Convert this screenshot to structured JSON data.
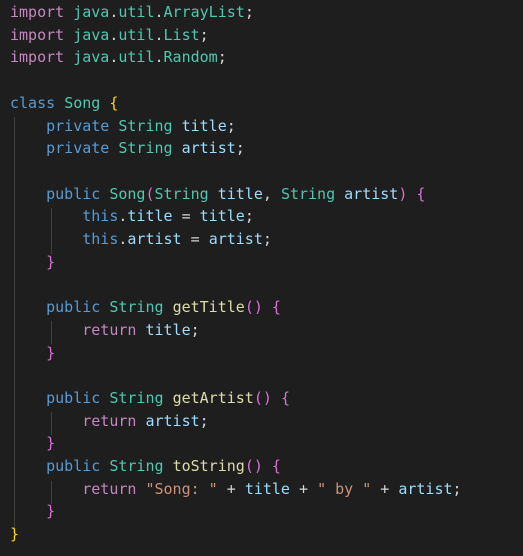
{
  "editor": {
    "language": "java",
    "theme": "dark",
    "colors": {
      "background": "#1e1e1e",
      "keyword": "#569cd6",
      "control_keyword": "#c586c0",
      "type": "#4ec9b0",
      "variable": "#9cdcfe",
      "function": "#dcdcaa",
      "string": "#ce9178",
      "bracket_level1": "#ffd700",
      "bracket_level2": "#da70d6",
      "bracket_level3": "#179fff"
    },
    "lines": [
      [
        {
          "t": "import",
          "c": "ctrl"
        },
        {
          "t": " ",
          "c": "plain"
        },
        {
          "t": "java",
          "c": "type"
        },
        {
          "t": ".",
          "c": "plain"
        },
        {
          "t": "util",
          "c": "type"
        },
        {
          "t": ".",
          "c": "plain"
        },
        {
          "t": "ArrayList",
          "c": "type"
        },
        {
          "t": ";",
          "c": "plain"
        }
      ],
      [
        {
          "t": "import",
          "c": "ctrl"
        },
        {
          "t": " ",
          "c": "plain"
        },
        {
          "t": "java",
          "c": "type"
        },
        {
          "t": ".",
          "c": "plain"
        },
        {
          "t": "util",
          "c": "type"
        },
        {
          "t": ".",
          "c": "plain"
        },
        {
          "t": "List",
          "c": "type"
        },
        {
          "t": ";",
          "c": "plain"
        }
      ],
      [
        {
          "t": "import",
          "c": "ctrl"
        },
        {
          "t": " ",
          "c": "plain"
        },
        {
          "t": "java",
          "c": "type"
        },
        {
          "t": ".",
          "c": "plain"
        },
        {
          "t": "util",
          "c": "type"
        },
        {
          "t": ".",
          "c": "plain"
        },
        {
          "t": "Random",
          "c": "type"
        },
        {
          "t": ";",
          "c": "plain"
        }
      ],
      [],
      [
        {
          "t": "class",
          "c": "kw"
        },
        {
          "t": " ",
          "c": "plain"
        },
        {
          "t": "Song",
          "c": "type"
        },
        {
          "t": " ",
          "c": "plain"
        },
        {
          "t": "{",
          "c": "b1"
        }
      ],
      [
        {
          "t": "    ",
          "c": "plain"
        },
        {
          "t": "private",
          "c": "kw"
        },
        {
          "t": " ",
          "c": "plain"
        },
        {
          "t": "String",
          "c": "type"
        },
        {
          "t": " ",
          "c": "plain"
        },
        {
          "t": "title",
          "c": "var"
        },
        {
          "t": ";",
          "c": "plain"
        }
      ],
      [
        {
          "t": "    ",
          "c": "plain"
        },
        {
          "t": "private",
          "c": "kw"
        },
        {
          "t": " ",
          "c": "plain"
        },
        {
          "t": "String",
          "c": "type"
        },
        {
          "t": " ",
          "c": "plain"
        },
        {
          "t": "artist",
          "c": "var"
        },
        {
          "t": ";",
          "c": "plain"
        }
      ],
      [],
      [
        {
          "t": "    ",
          "c": "plain"
        },
        {
          "t": "public",
          "c": "kw"
        },
        {
          "t": " ",
          "c": "plain"
        },
        {
          "t": "Song",
          "c": "type"
        },
        {
          "t": "(",
          "c": "b2"
        },
        {
          "t": "String",
          "c": "type"
        },
        {
          "t": " ",
          "c": "plain"
        },
        {
          "t": "title",
          "c": "var"
        },
        {
          "t": ", ",
          "c": "plain"
        },
        {
          "t": "String",
          "c": "type"
        },
        {
          "t": " ",
          "c": "plain"
        },
        {
          "t": "artist",
          "c": "var"
        },
        {
          "t": ")",
          "c": "b2"
        },
        {
          "t": " ",
          "c": "plain"
        },
        {
          "t": "{",
          "c": "b2"
        }
      ],
      [
        {
          "t": "        ",
          "c": "plain"
        },
        {
          "t": "this",
          "c": "kw"
        },
        {
          "t": ".",
          "c": "plain"
        },
        {
          "t": "title",
          "c": "var"
        },
        {
          "t": " = ",
          "c": "plain"
        },
        {
          "t": "title",
          "c": "var"
        },
        {
          "t": ";",
          "c": "plain"
        }
      ],
      [
        {
          "t": "        ",
          "c": "plain"
        },
        {
          "t": "this",
          "c": "kw"
        },
        {
          "t": ".",
          "c": "plain"
        },
        {
          "t": "artist",
          "c": "var"
        },
        {
          "t": " = ",
          "c": "plain"
        },
        {
          "t": "artist",
          "c": "var"
        },
        {
          "t": ";",
          "c": "plain"
        }
      ],
      [
        {
          "t": "    ",
          "c": "plain"
        },
        {
          "t": "}",
          "c": "b2"
        }
      ],
      [],
      [
        {
          "t": "    ",
          "c": "plain"
        },
        {
          "t": "public",
          "c": "kw"
        },
        {
          "t": " ",
          "c": "plain"
        },
        {
          "t": "String",
          "c": "type"
        },
        {
          "t": " ",
          "c": "plain"
        },
        {
          "t": "getTitle",
          "c": "fn"
        },
        {
          "t": "()",
          "c": "b2"
        },
        {
          "t": " ",
          "c": "plain"
        },
        {
          "t": "{",
          "c": "b2"
        }
      ],
      [
        {
          "t": "        ",
          "c": "plain"
        },
        {
          "t": "return",
          "c": "ctrl"
        },
        {
          "t": " ",
          "c": "plain"
        },
        {
          "t": "title",
          "c": "var"
        },
        {
          "t": ";",
          "c": "plain"
        }
      ],
      [
        {
          "t": "    ",
          "c": "plain"
        },
        {
          "t": "}",
          "c": "b2"
        }
      ],
      [],
      [
        {
          "t": "    ",
          "c": "plain"
        },
        {
          "t": "public",
          "c": "kw"
        },
        {
          "t": " ",
          "c": "plain"
        },
        {
          "t": "String",
          "c": "type"
        },
        {
          "t": " ",
          "c": "plain"
        },
        {
          "t": "getArtist",
          "c": "fn"
        },
        {
          "t": "()",
          "c": "b2"
        },
        {
          "t": " ",
          "c": "plain"
        },
        {
          "t": "{",
          "c": "b2"
        }
      ],
      [
        {
          "t": "        ",
          "c": "plain"
        },
        {
          "t": "return",
          "c": "ctrl"
        },
        {
          "t": " ",
          "c": "plain"
        },
        {
          "t": "artist",
          "c": "var"
        },
        {
          "t": ";",
          "c": "plain"
        }
      ],
      [
        {
          "t": "    ",
          "c": "plain"
        },
        {
          "t": "}",
          "c": "b2"
        }
      ],
      [
        {
          "t": "    ",
          "c": "plain"
        },
        {
          "t": "public",
          "c": "kw"
        },
        {
          "t": " ",
          "c": "plain"
        },
        {
          "t": "String",
          "c": "type"
        },
        {
          "t": " ",
          "c": "plain"
        },
        {
          "t": "toString",
          "c": "fn"
        },
        {
          "t": "()",
          "c": "b2"
        },
        {
          "t": " ",
          "c": "plain"
        },
        {
          "t": "{",
          "c": "b2"
        }
      ],
      [
        {
          "t": "        ",
          "c": "plain"
        },
        {
          "t": "return",
          "c": "ctrl"
        },
        {
          "t": " ",
          "c": "plain"
        },
        {
          "t": "\"Song: \"",
          "c": "str"
        },
        {
          "t": " + ",
          "c": "plain"
        },
        {
          "t": "title",
          "c": "var"
        },
        {
          "t": " + ",
          "c": "plain"
        },
        {
          "t": "\" by \"",
          "c": "str"
        },
        {
          "t": " + ",
          "c": "plain"
        },
        {
          "t": "artist",
          "c": "var"
        },
        {
          "t": ";",
          "c": "plain"
        }
      ],
      [
        {
          "t": "    ",
          "c": "plain"
        },
        {
          "t": "}",
          "c": "b2"
        }
      ],
      [
        {
          "t": "}",
          "c": "b1"
        }
      ]
    ]
  }
}
